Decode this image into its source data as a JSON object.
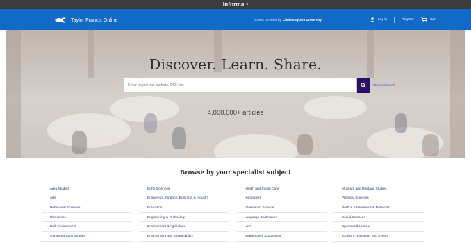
{
  "top_strip": {
    "label": "informa",
    "caret": "▾"
  },
  "header": {
    "brand": "Taylor Francis Online",
    "access_prefix": "Access provided by",
    "access_institution": "Chulalongkorn University",
    "login": "Log in",
    "register": "Register",
    "cart": "Cart"
  },
  "hero": {
    "title": "Discover. Learn. Share.",
    "search_placeholder": "Enter keywords, authors, DOI etc.",
    "advanced_search": "Advanced search",
    "count": "4,000,000+ articles"
  },
  "browse": {
    "title": "Browse by your specialist subject",
    "columns": [
      [
        "Area Studies",
        "Arts",
        "Behavioral Sciences",
        "Bioscience",
        "Built Environment",
        "Communication Studies"
      ],
      [
        "Earth Sciences",
        "Economics, Finance, Business & Industry",
        "Education",
        "Engineering & Technology",
        "Environment & Agriculture",
        "Environment and Sustainability"
      ],
      [
        "Health and Social Care",
        "Humanities",
        "Information Science",
        "Language & Literature",
        "Law",
        "Mathematics & Statistics"
      ],
      [
        "Museum and Heritage Studies",
        "Physical Sciences",
        "Politics & International Relations",
        "Social Sciences",
        "Sports and Leisure",
        "Tourism, Hospitality and Events"
      ]
    ]
  },
  "colors": {
    "header_blue": "#1169c8",
    "top_strip": "#3c3c3c",
    "search_button": "#2a0e6a",
    "subject_link": "#2e3b7a"
  },
  "icons": [
    "tf-logo-icon",
    "caret-down-icon",
    "user-icon",
    "cart-icon",
    "search-icon"
  ]
}
